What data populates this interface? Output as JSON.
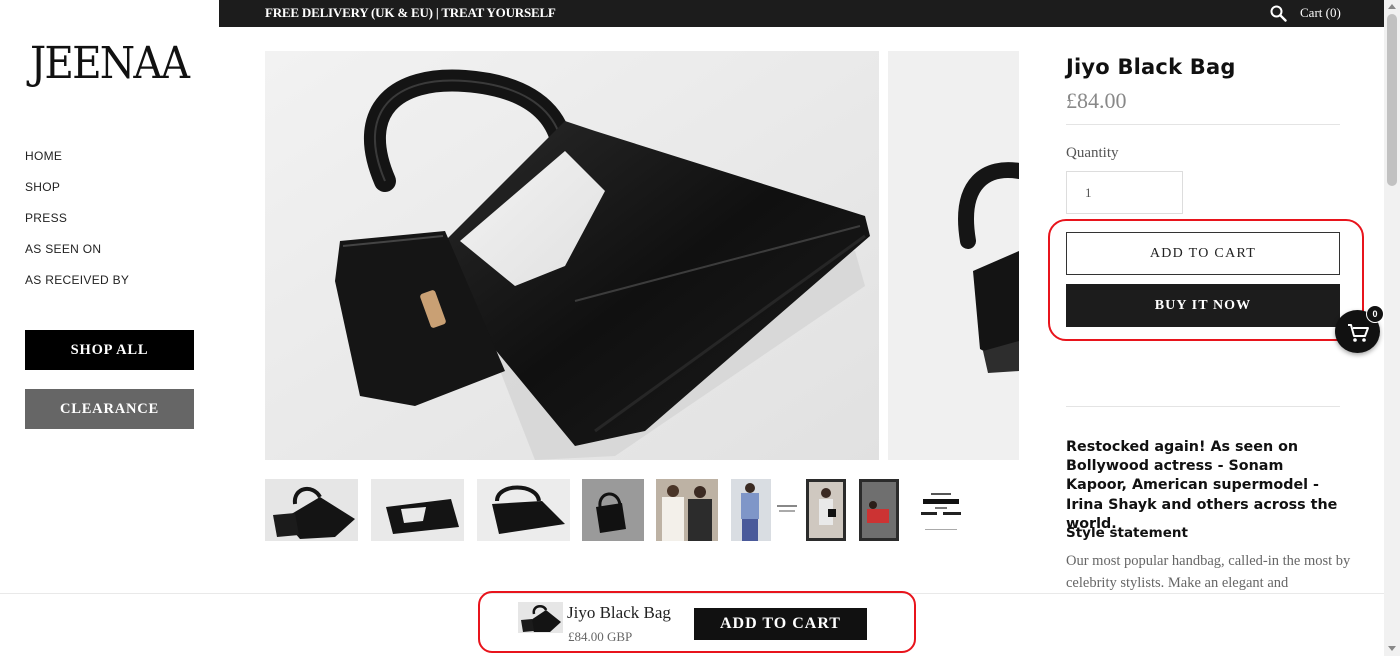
{
  "brand": {
    "logo_text": "JEENAA"
  },
  "sidebar": {
    "nav": [
      {
        "label": "HOME"
      },
      {
        "label": "SHOP"
      },
      {
        "label": "PRESS"
      },
      {
        "label": "AS SEEN ON"
      },
      {
        "label": "AS RECEIVED BY"
      }
    ],
    "shop_all_label": "SHOP ALL",
    "clearance_label": "CLEARANCE"
  },
  "topbar": {
    "promo": "FREE DELIVERY (UK & EU) | TREAT YOURSELF",
    "search_icon": "search-icon",
    "cart_label": "Cart (0)"
  },
  "gallery": {
    "thumbnails": [
      {
        "icon": "bag-photo"
      },
      {
        "icon": "bag-photo"
      },
      {
        "icon": "bag-photo"
      },
      {
        "icon": "bag-photo"
      },
      {
        "icon": "people-photo"
      },
      {
        "icon": "people-photo"
      },
      {
        "icon": "people-photo"
      },
      {
        "icon": "people-photo"
      },
      {
        "icon": "press-clipping"
      }
    ]
  },
  "product": {
    "title": "Jiyo Black Bag",
    "price": "£84.00",
    "quantity_label": "Quantity",
    "quantity_value": "1",
    "add_to_cart_label": "ADD TO CART",
    "buy_now_label": "BUY IT NOW",
    "description_bold": "Restocked again! As seen on Bollywood actress - Sonam Kapoor, American supermodel - Irina Shayk and others across the world.",
    "style_heading": "Style statement",
    "description_text": "Our most popular handbag, called-in the most by celebrity stylists. Make an elegant and"
  },
  "floating_cart": {
    "count": "0",
    "icon": "cart-icon"
  },
  "sticky_bar": {
    "title": "Jiyo Black Bag",
    "price": "£84.00 GBP",
    "button_label": "ADD TO CART"
  },
  "colors": {
    "topbar_bg": "#1c1c1c",
    "highlight_red": "#e8141c",
    "clearance_bg": "#666666"
  }
}
